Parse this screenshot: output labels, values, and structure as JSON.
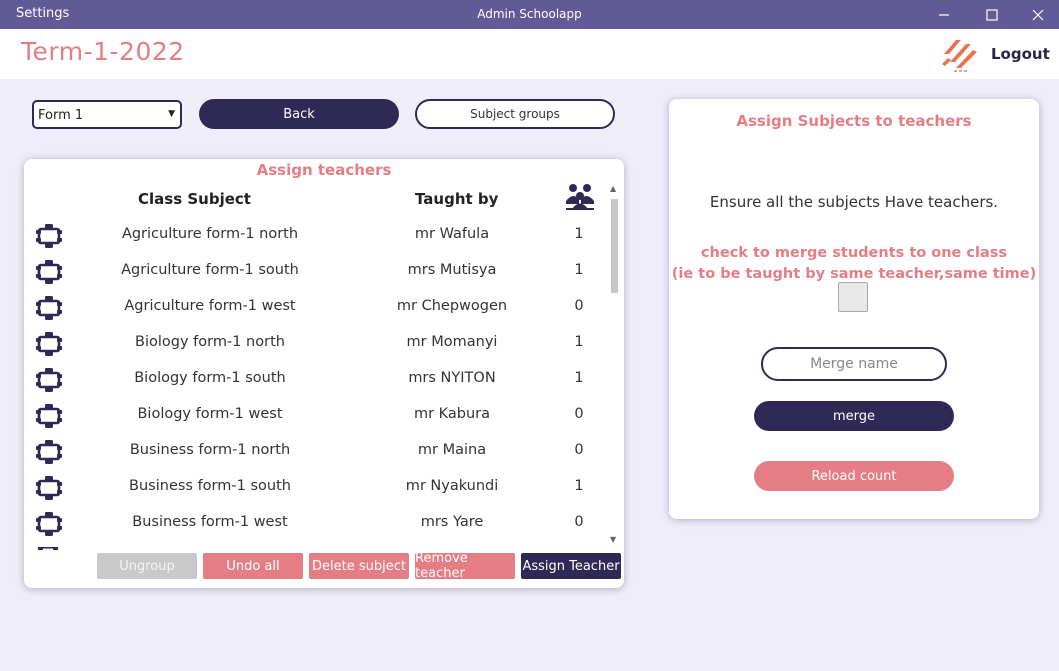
{
  "window": {
    "app_label": "Settings",
    "title": "Admin Schoolapp"
  },
  "header": {
    "term": "Term-1-2022",
    "logout": "Logout"
  },
  "controls": {
    "form_select_value": "Form 1",
    "back": "Back",
    "subject_groups": "Subject groups"
  },
  "assign_card": {
    "title": "Assign teachers",
    "col_subject": "Class Subject",
    "col_taught_by": "Taught by",
    "rows": [
      {
        "subject": "Agriculture form-1 north",
        "teacher": "mr Wafula",
        "count": "1"
      },
      {
        "subject": "Agriculture form-1 south",
        "teacher": "mrs Mutisya",
        "count": "1"
      },
      {
        "subject": "Agriculture form-1 west",
        "teacher": "mr Chepwogen",
        "count": "0"
      },
      {
        "subject": "Biology form-1 north",
        "teacher": "mr Momanyi",
        "count": "1"
      },
      {
        "subject": "Biology form-1 south",
        "teacher": "mrs NYITON",
        "count": "1"
      },
      {
        "subject": "Biology form-1 west",
        "teacher": "mr Kabura",
        "count": "0"
      },
      {
        "subject": "Business form-1 north",
        "teacher": "mr Maina",
        "count": "0"
      },
      {
        "subject": "Business form-1 south",
        "teacher": "mr Nyakundi",
        "count": "1"
      },
      {
        "subject": "Business form-1 west",
        "teacher": "mrs Yare",
        "count": "0"
      }
    ],
    "buttons": {
      "ungroup": "Ungroup",
      "undo_all": "Undo all",
      "delete_subject": "Delete subject",
      "remove_teacher": "Remove teacher",
      "assign_teacher": "Assign Teacher"
    }
  },
  "right_card": {
    "title": "Assign Subjects to teachers",
    "ensure": "Ensure all the subjects Have teachers.",
    "merge_note_line1": "check to merge students to one class",
    "merge_note_line2": "(ie to be taught by same teacher,same time)",
    "merge_placeholder": "Merge name",
    "merge": "merge",
    "reload": "Reload count"
  },
  "colors": {
    "titlebar": "#625a96",
    "navy": "#2f2a55",
    "accent_pink": "#e57e84",
    "background": "#efeef8"
  },
  "icons": {
    "row_icon": "group-node-icon",
    "count_header": "people-group-icon"
  }
}
